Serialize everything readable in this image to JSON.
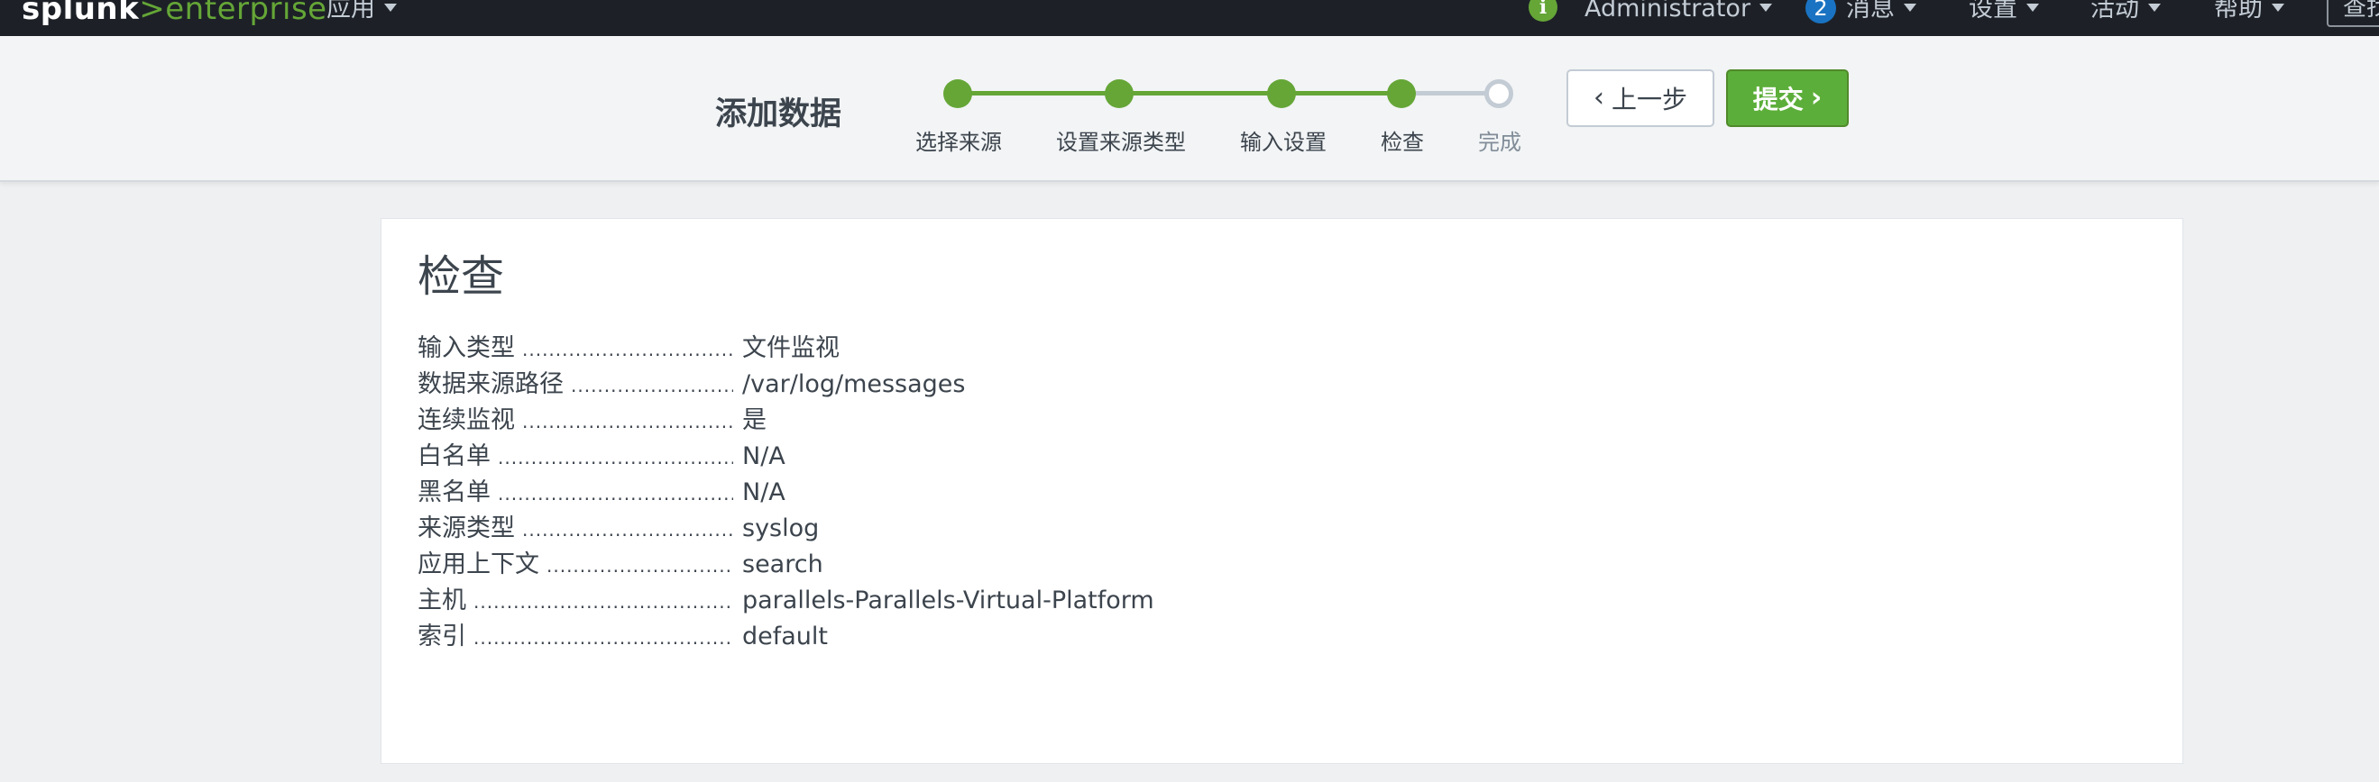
{
  "topbar": {
    "logo_part1": "splunk",
    "logo_part2": ">",
    "logo_part3": "enterprise",
    "apps_menu": "应用",
    "user_menu": "Administrator",
    "messages_count": "2",
    "messages_menu": "消息",
    "settings_menu": "设置",
    "activity_menu": "活动",
    "help_menu": "帮助",
    "search_label": "查找"
  },
  "wizard": {
    "title": "添加数据",
    "steps": [
      {
        "label": "选择来源",
        "state": "done"
      },
      {
        "label": "设置来源类型",
        "state": "done"
      },
      {
        "label": "输入设置",
        "state": "done"
      },
      {
        "label": "检查",
        "state": "current"
      },
      {
        "label": "完成",
        "state": "pending"
      }
    ],
    "back_label": "上一步",
    "submit_label": "提交"
  },
  "review": {
    "heading": "检查",
    "rows": [
      {
        "label": "输入类型",
        "value": "文件监视"
      },
      {
        "label": "数据来源路径",
        "value": "/var/log/messages"
      },
      {
        "label": "连续监视",
        "value": "是"
      },
      {
        "label": "白名单",
        "value": "N/A"
      },
      {
        "label": "黑名单",
        "value": "N/A"
      },
      {
        "label": "来源类型",
        "value": "syslog"
      },
      {
        "label": "应用上下文",
        "value": "search"
      },
      {
        "label": "主机",
        "value": "parallels-Parallels-Virtual-Platform"
      },
      {
        "label": "索引",
        "value": "default"
      }
    ]
  },
  "colors": {
    "topbar_bg": "#1d2127",
    "brand_green": "#65a637",
    "submit_green": "#5cae3a",
    "badge_blue": "#1a73c2",
    "pending_gray": "#c3cbd4"
  }
}
